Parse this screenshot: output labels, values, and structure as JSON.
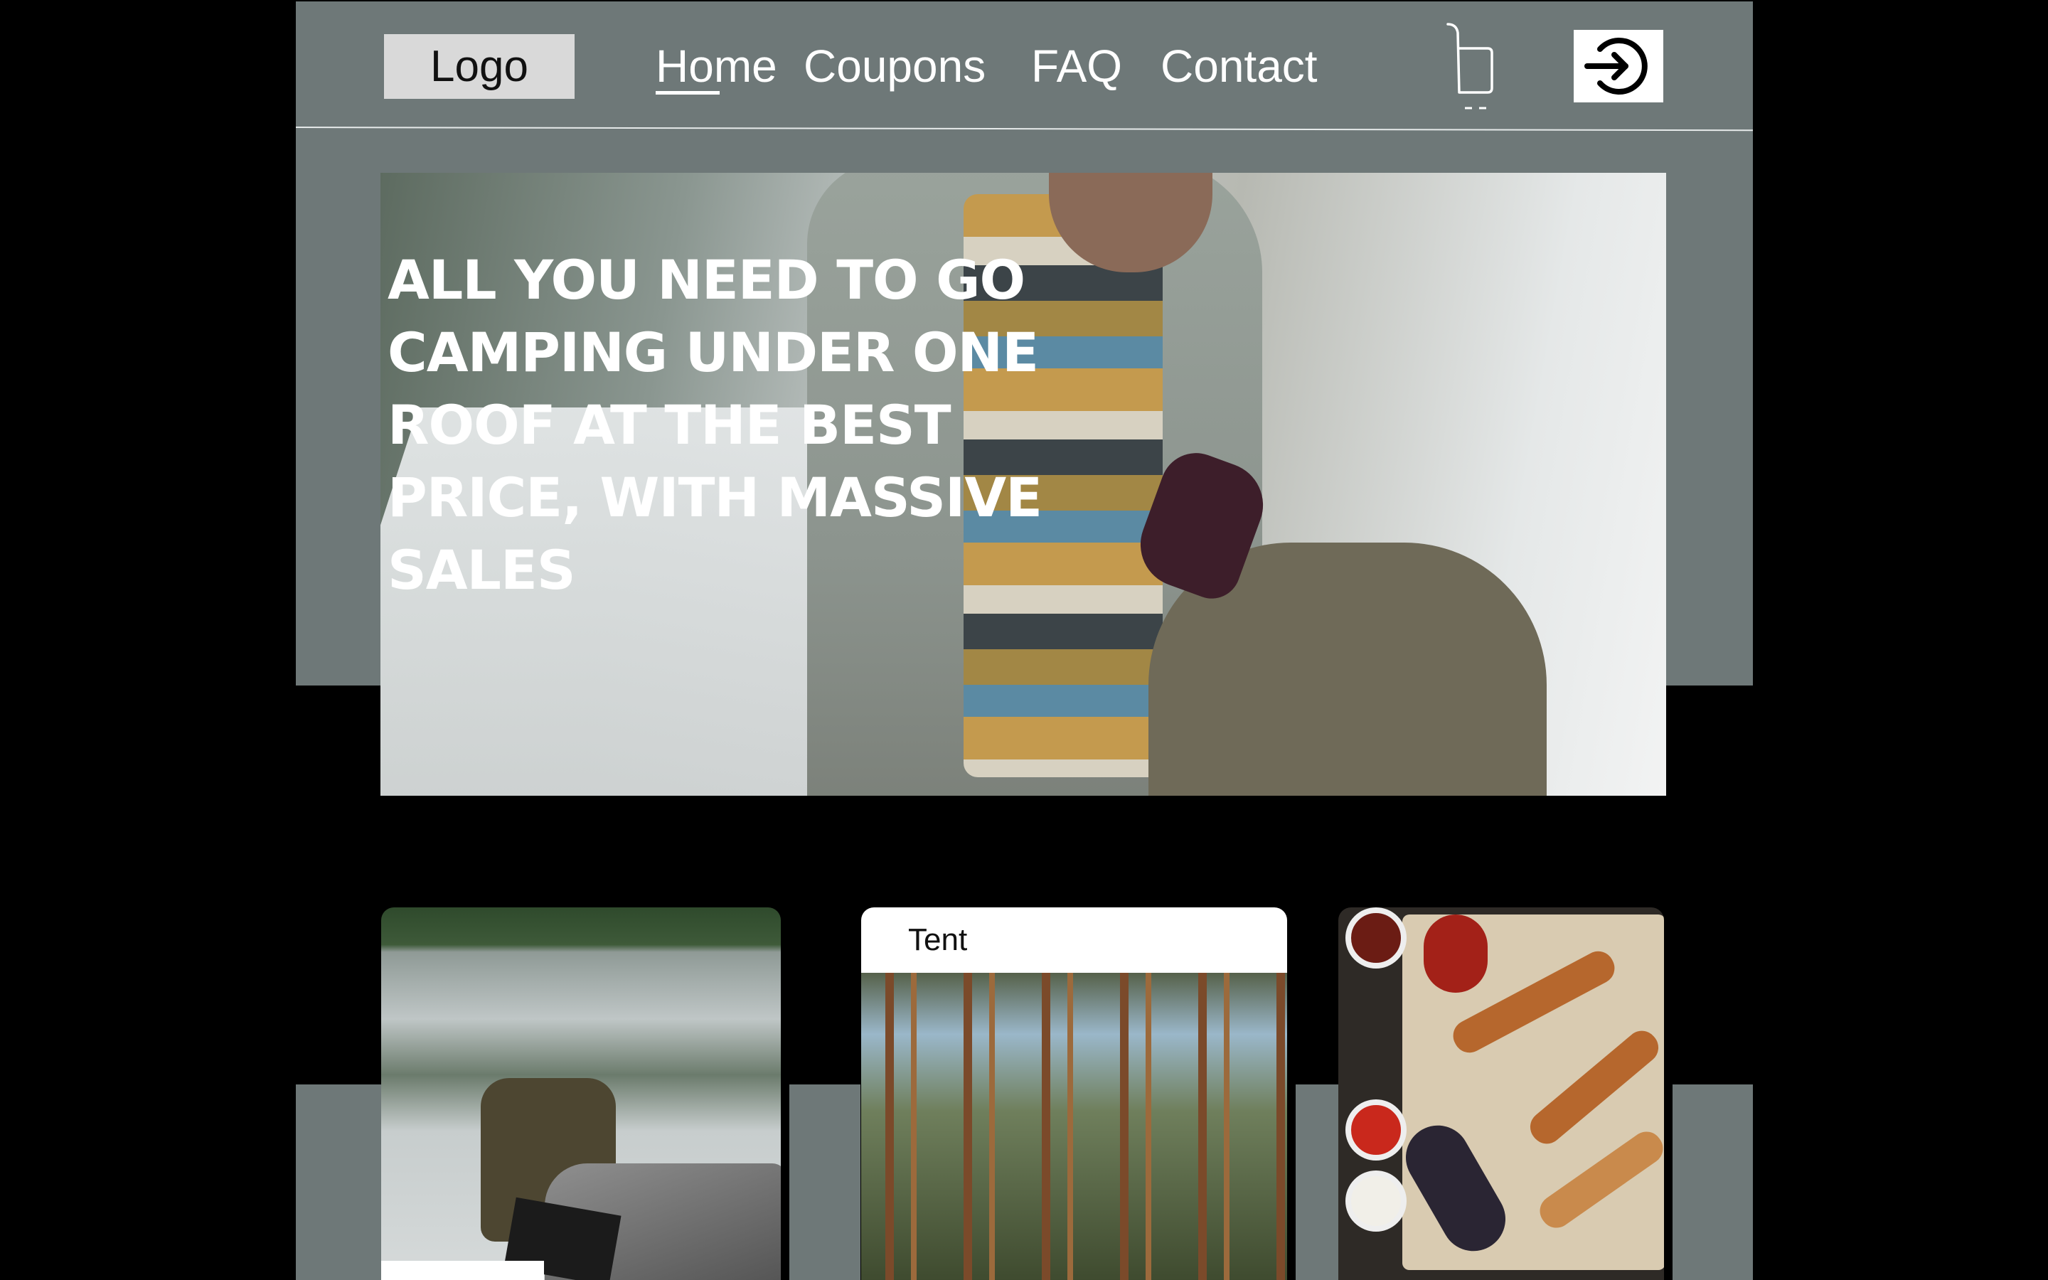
{
  "header": {
    "logo_label": "Logo",
    "nav": [
      {
        "label": "Home",
        "active": true
      },
      {
        "label": "Coupons",
        "active": false
      },
      {
        "label": "FAQ",
        "active": false
      },
      {
        "label": "Contact",
        "active": false
      }
    ],
    "cart_icon": "shopping-cart-icon",
    "login_icon": "login-arrow-icon"
  },
  "hero": {
    "heading": "ALL YOU NEED TO GO CAMPING UNDER ONE ROOF AT THE BEST PRICE, WITH MASSIVE SALES",
    "image": "camper-crouching-by-tent-photo"
  },
  "categories": [
    {
      "title": "",
      "image": "backpack-by-lake-photo"
    },
    {
      "title": "Tent",
      "image": "pine-forest-photo"
    },
    {
      "title": "",
      "image": "grilled-food-platter-photo"
    }
  ],
  "colors": {
    "background": "#000000",
    "panel": "#6e7878",
    "text_light": "#ffffff",
    "logo_box": "#d9d9d9"
  }
}
